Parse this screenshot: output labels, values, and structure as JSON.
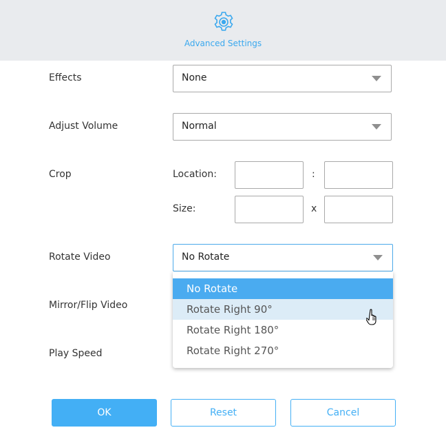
{
  "header": {
    "title": "Advanced Settings",
    "icon": "gear-icon",
    "accent_color": "#3aa8ee"
  },
  "rows": {
    "effects": {
      "label": "Effects",
      "value": "None"
    },
    "volume": {
      "label": "Adjust Volume",
      "value": "Normal"
    },
    "crop": {
      "label": "Crop",
      "location_label": "Location:",
      "location_separator": ":",
      "size_label": "Size:",
      "size_separator": "x",
      "location_x": "",
      "location_y": "",
      "size_w": "",
      "size_h": ""
    },
    "rotate": {
      "label": "Rotate Video",
      "value": "No Rotate"
    },
    "mirror": {
      "label": "Mirror/Flip Video"
    },
    "speed": {
      "label": "Play Speed"
    }
  },
  "rotate_dropdown": {
    "options": [
      "No Rotate",
      "Rotate Right 90°",
      "Rotate Right 180°",
      "Rotate Right 270°"
    ],
    "selected": "No Rotate",
    "hovered": "Rotate Right 90°"
  },
  "buttons": {
    "ok": "OK",
    "reset": "Reset",
    "cancel": "Cancel"
  }
}
